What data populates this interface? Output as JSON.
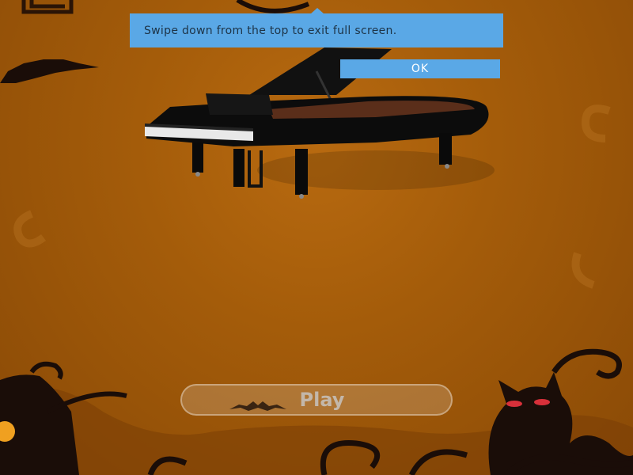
{
  "toast": {
    "message": "Swipe down from the top to exit full screen.",
    "ok_label": "OK"
  },
  "game": {
    "play_label": "Play"
  },
  "colors": {
    "background": "#a45c0a",
    "toast_bg": "#5aa8e6",
    "silhouette": "#1a0d08",
    "cat_eyes": "#d8303a"
  },
  "icons": [
    "bat-icon",
    "piano-illustration",
    "cat-silhouette-icon",
    "house-silhouette-icon"
  ]
}
